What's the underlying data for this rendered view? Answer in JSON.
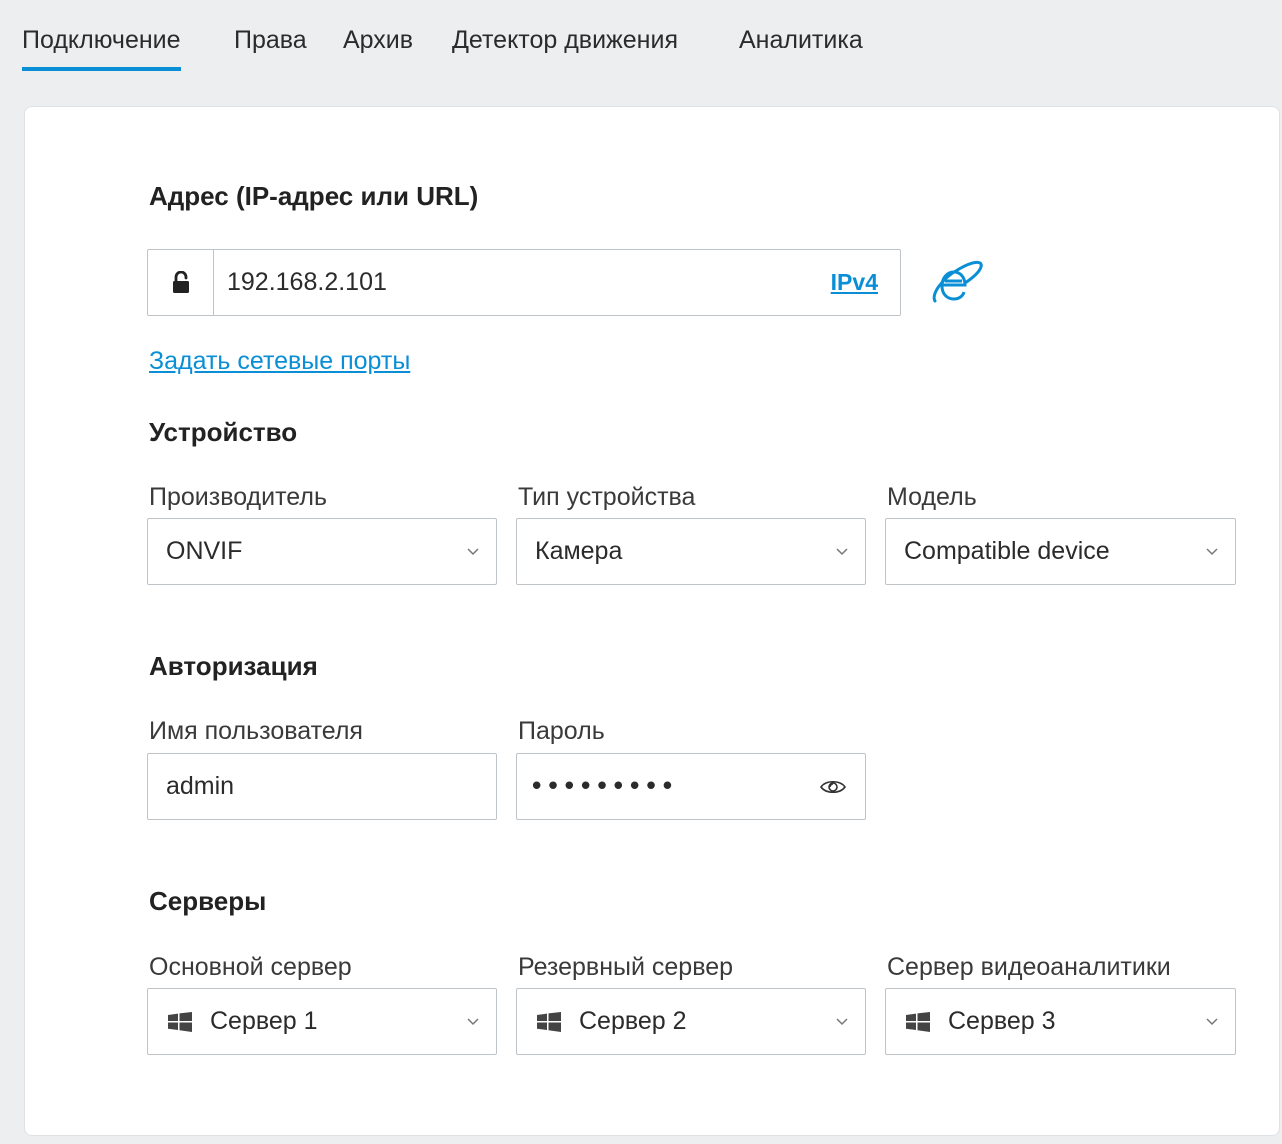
{
  "tabs": [
    {
      "label": "Подключение",
      "active": true
    },
    {
      "label": "Права",
      "active": false
    },
    {
      "label": "Архив",
      "active": false
    },
    {
      "label": "Детектор движения",
      "active": false
    },
    {
      "label": "Аналитика",
      "active": false
    }
  ],
  "address": {
    "title": "Адрес (IP-адрес или URL)",
    "value": "192.168.2.101",
    "ip_version": "IPv4",
    "lock_icon": "unlock-icon",
    "browser_icon": "internet-explorer-icon",
    "ports_link": "Задать сетевые порты"
  },
  "device": {
    "title": "Устройство",
    "manufacturer_label": "Производитель",
    "manufacturer_value": "ONVIF",
    "type_label": "Тип устройства",
    "type_value": "Камера",
    "model_label": "Модель",
    "model_value": "Compatible device"
  },
  "auth": {
    "title": "Авторизация",
    "username_label": "Имя пользователя",
    "username_value": "admin",
    "password_label": "Пароль",
    "password_masked": "•••••••••",
    "eye_icon": "eye-icon"
  },
  "servers": {
    "title": "Серверы",
    "primary_label": "Основной сервер",
    "primary_value": "Сервер 1",
    "backup_label": "Резервный сервер",
    "backup_value": "Сервер 2",
    "analytics_label": "Сервер видеоаналитики",
    "analytics_value": "Сервер 3",
    "server_icon": "windows-icon"
  },
  "colors": {
    "accent": "#0a8fd6",
    "background": "#eceef0",
    "panel": "#ffffff",
    "border": "#bfc4c8"
  }
}
